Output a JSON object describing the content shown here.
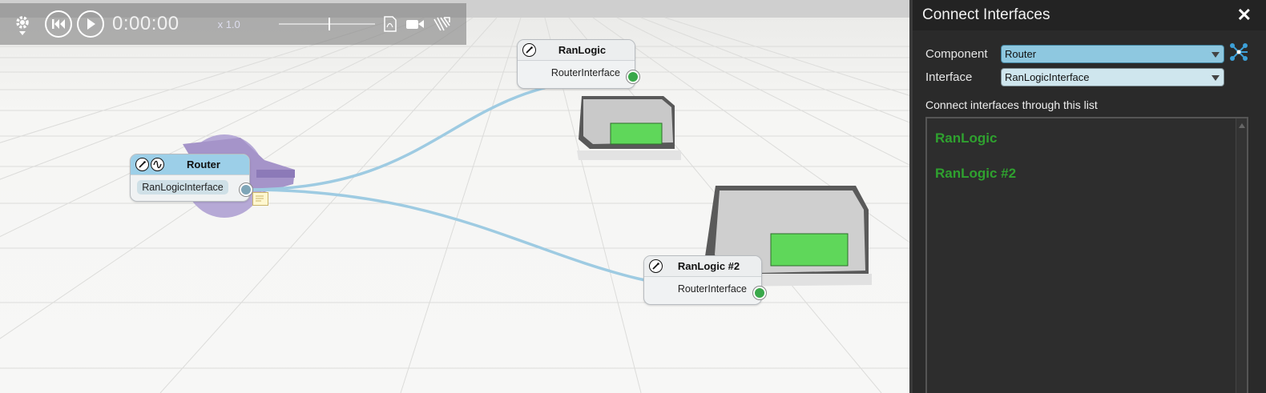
{
  "toolbar": {
    "time": "0:00:00",
    "speed": "x 1.0",
    "icons": [
      "gear-icon",
      "skip-to-start-icon",
      "play-icon",
      "pdf-icon",
      "video-camera-icon",
      "export-icon"
    ]
  },
  "viewport": {
    "nodes": [
      {
        "title": "Router",
        "port": "RanLogicInterface",
        "icons": [
          "speedometer-icon",
          "sine-wave-icon"
        ]
      },
      {
        "title": "RanLogic",
        "port": "RouterInterface",
        "icons": [
          "speedometer-icon"
        ]
      },
      {
        "title": "RanLogic #2",
        "port": "RouterInterface",
        "icons": [
          "speedometer-icon"
        ]
      }
    ],
    "colors": {
      "connection": "#9ecbe2",
      "connected_port": "#3aa84a",
      "device_screen": "#5fd75a"
    }
  },
  "panel": {
    "title": "Connect Interfaces",
    "component_label": "Component",
    "component_value": "Router",
    "interface_label": "Interface",
    "interface_value": "RanLogicInterface",
    "list_caption": "Connect interfaces through this list",
    "list_items": [
      "RanLogic",
      "RanLogic #2"
    ],
    "colors": {
      "list_item": "#2fa12f",
      "component_select": "#8ec8e0",
      "interface_select": "#cfe6ee"
    }
  }
}
